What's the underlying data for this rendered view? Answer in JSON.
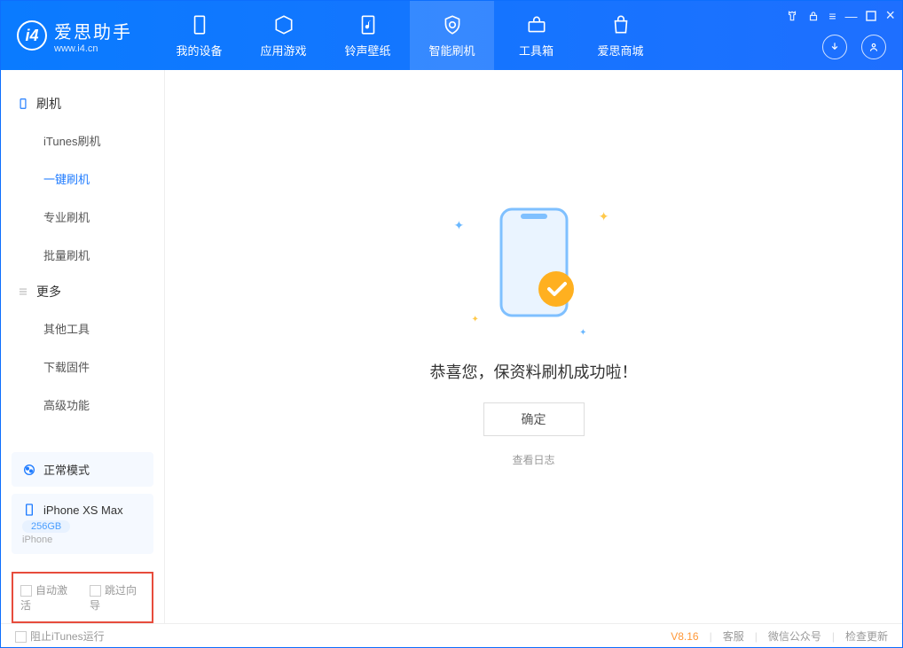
{
  "header": {
    "app_name_cn": "爱思助手",
    "app_name_en": "www.i4.cn",
    "tabs": [
      {
        "label": "我的设备"
      },
      {
        "label": "应用游戏"
      },
      {
        "label": "铃声壁纸"
      },
      {
        "label": "智能刷机"
      },
      {
        "label": "工具箱"
      },
      {
        "label": "爱思商城"
      }
    ]
  },
  "sidebar": {
    "section1_title": "刷机",
    "section1_items": [
      "iTunes刷机",
      "一键刷机",
      "专业刷机",
      "批量刷机"
    ],
    "section2_title": "更多",
    "section2_items": [
      "其他工具",
      "下载固件",
      "高级功能"
    ],
    "mode_box": {
      "label": "正常模式"
    },
    "device_box": {
      "name": "iPhone XS Max",
      "capacity": "256GB",
      "type": "iPhone"
    },
    "opt_auto_activate": "自动激活",
    "opt_skip_guide": "跳过向导"
  },
  "main": {
    "success_text": "恭喜您，保资料刷机成功啦！",
    "ok_button": "确定",
    "view_log": "查看日志"
  },
  "footer": {
    "block_itunes": "阻止iTunes运行",
    "version": "V8.16",
    "links": [
      "客服",
      "微信公众号",
      "检查更新"
    ]
  }
}
